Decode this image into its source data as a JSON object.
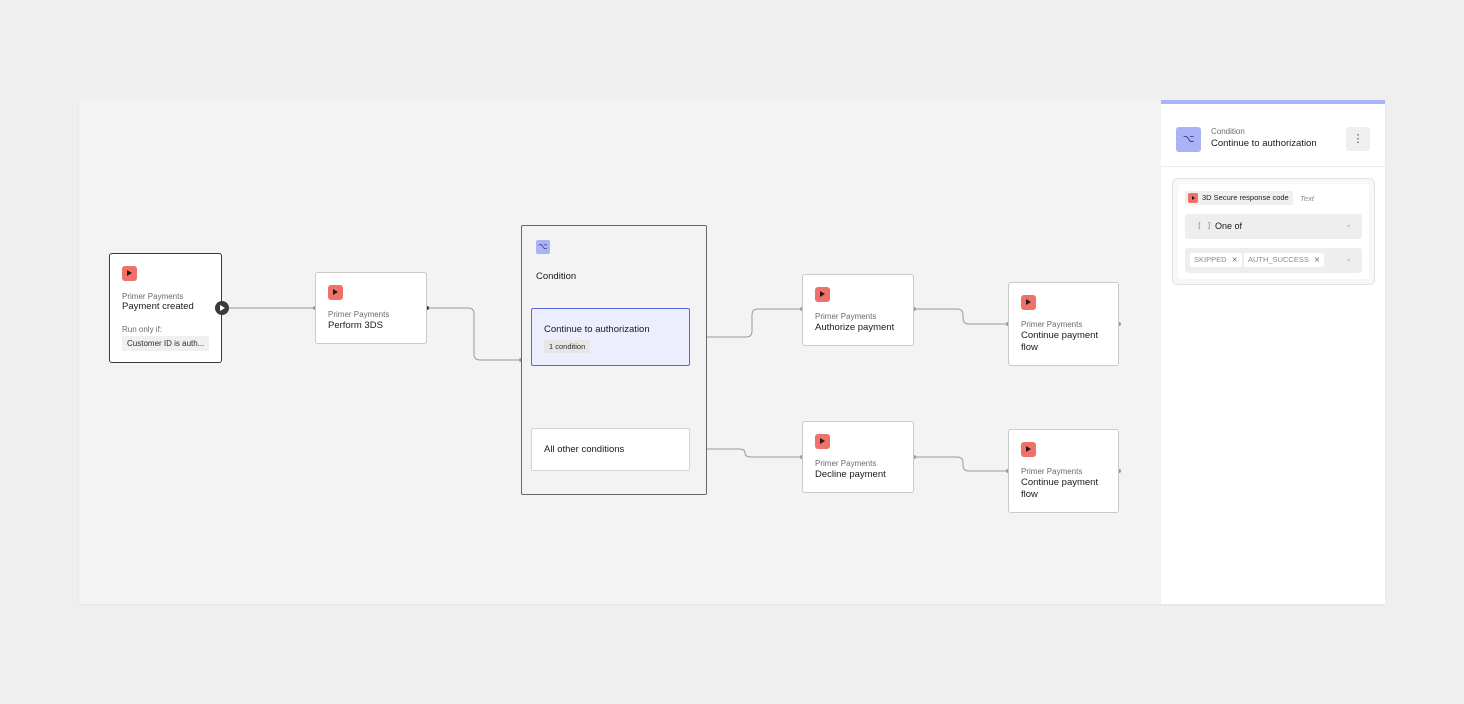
{
  "canvas": {
    "trigger": {
      "kicker": "Primer Payments",
      "title": "Payment created",
      "run_only_if_label": "Run only if:",
      "condition_chip": "Customer ID is auth..."
    },
    "perform_3ds": {
      "kicker": "Primer Payments",
      "title": "Perform 3DS"
    },
    "condition_group": {
      "title": "Condition",
      "icon": "branch-icon",
      "branches": [
        {
          "title": "Continue to authorization",
          "badge": "1 condition"
        },
        {
          "title": "All other conditions"
        }
      ]
    },
    "authorize": {
      "kicker": "Primer Payments",
      "title": "Authorize payment"
    },
    "decline": {
      "kicker": "Primer Payments",
      "title": "Decline payment"
    },
    "continue_top": {
      "kicker": "Primer Payments",
      "title_line1": "Continue payment",
      "title_line2": "flow"
    },
    "continue_bottom": {
      "kicker": "Primer Payments",
      "title_line1": "Continue payment",
      "title_line2": "flow"
    }
  },
  "panel": {
    "kicker": "Condition",
    "title": "Continue to authorization",
    "menu_icon": "⋮",
    "rule": {
      "field": "3D Secure response code",
      "field_type": "Text",
      "operator_glyph": "[ ]",
      "operator": "One of",
      "values": [
        "SKIPPED",
        "AUTH_SUCCESS"
      ]
    }
  },
  "colors": {
    "brand": "#f0706a",
    "condition_accent": "#aab3f5",
    "selected_border": "#5867e0",
    "selected_fill": "#eceefe"
  }
}
